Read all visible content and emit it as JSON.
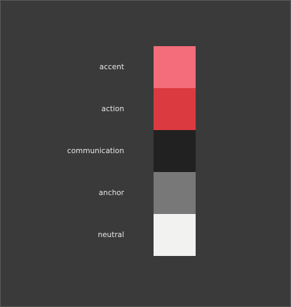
{
  "background": "#3a3a3a",
  "swatches": [
    {
      "label": "accent",
      "color": "#f36d7b"
    },
    {
      "label": "action",
      "color": "#db3a40"
    },
    {
      "label": "communication",
      "color": "#212121"
    },
    {
      "label": "anchor",
      "color": "#787878"
    },
    {
      "label": "neutral",
      "color": "#f2f2f0"
    }
  ]
}
